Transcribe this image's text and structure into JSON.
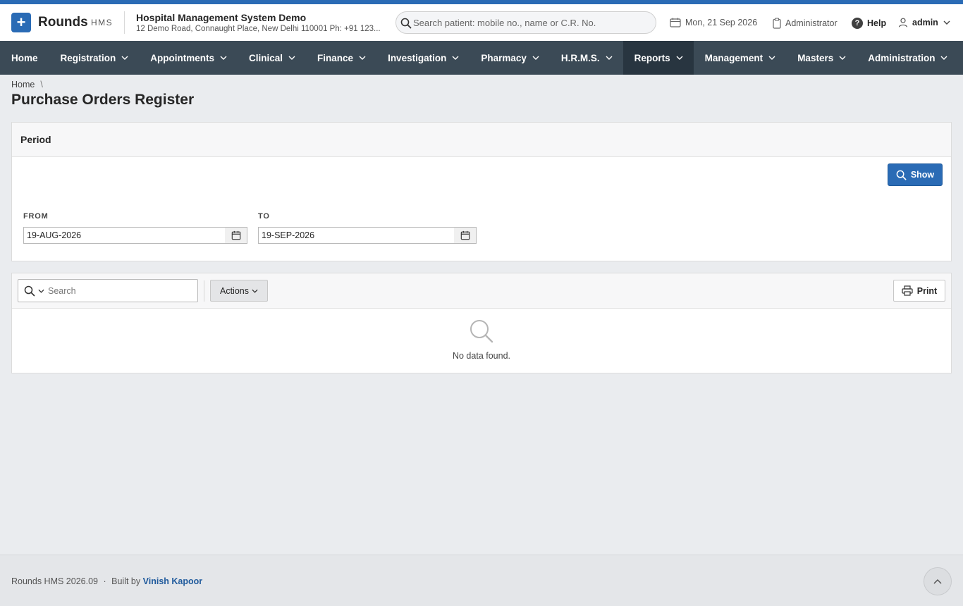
{
  "brand": {
    "name": "Rounds",
    "sub": "HMS"
  },
  "org": {
    "name": "Hospital Management System Demo",
    "address": "12 Demo Road, Connaught Place, New Delhi 110001 Ph: +91 123..."
  },
  "header": {
    "search_placeholder": "Search patient: mobile no., name or C.R. No.",
    "date": "Mon, 21 Sep 2026",
    "role": "Administrator",
    "help": "Help",
    "user": "admin"
  },
  "nav": {
    "items": [
      {
        "label": "Home"
      },
      {
        "label": "Registration"
      },
      {
        "label": "Appointments"
      },
      {
        "label": "Clinical"
      },
      {
        "label": "Finance"
      },
      {
        "label": "Investigation"
      },
      {
        "label": "Pharmacy"
      },
      {
        "label": "H.R.M.S."
      },
      {
        "label": "Reports"
      },
      {
        "label": "Management"
      },
      {
        "label": "Masters"
      },
      {
        "label": "Administration"
      }
    ],
    "active": "Reports"
  },
  "breadcrumb": {
    "home": "Home",
    "separator": "\\"
  },
  "page": {
    "title": "Purchase Orders Register"
  },
  "period": {
    "heading": "Period",
    "show_button": "Show",
    "from_label": "FROM",
    "from_value": "19-AUG-2026",
    "to_label": "TO",
    "to_value": "19-SEP-2026"
  },
  "report": {
    "search_placeholder": "Search",
    "actions_button": "Actions",
    "print_button": "Print",
    "empty_message": "No data found."
  },
  "footer": {
    "version": "Rounds HMS 2026.09",
    "separator": "·",
    "built_by": "Built by",
    "author": "Vinish Kapoor"
  },
  "colors": {
    "accent": "#2a6bb5",
    "nav_background": "#3b4a56",
    "nav_active": "#283540",
    "page_background": "#eaecef"
  }
}
